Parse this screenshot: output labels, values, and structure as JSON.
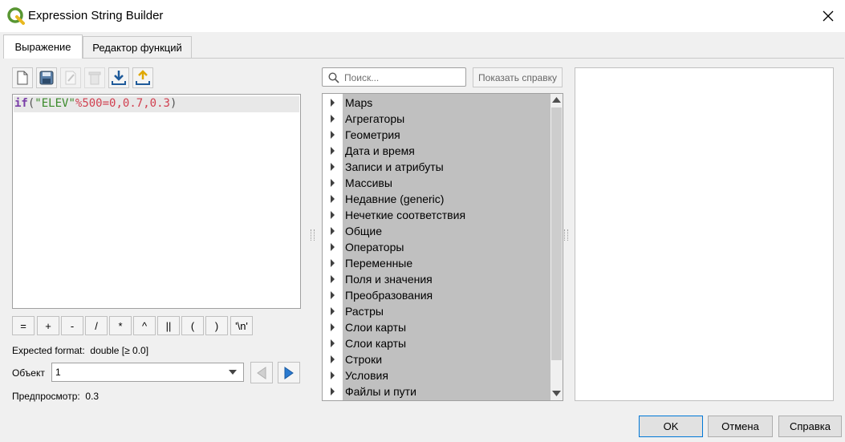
{
  "window": {
    "title": "Expression String Builder"
  },
  "tabs": [
    {
      "label": "Выражение"
    },
    {
      "label": "Редактор функций"
    }
  ],
  "editor": {
    "tokens": {
      "fn": "if",
      "open": "(",
      "field": "\"ELEV\"",
      "op1": "%",
      "n1": "500",
      "op2": "=",
      "n2": "0",
      "c1": ",",
      "n3": "0.7",
      "c2": ",",
      "n4": "0.3",
      "close": ")"
    }
  },
  "toolbar_icons": [
    "new-file-icon",
    "save-icon",
    "edit-icon",
    "delete-icon",
    "import-icon",
    "export-icon"
  ],
  "operators": [
    "=",
    "+",
    "-",
    "/",
    "*",
    "^",
    "||",
    "(",
    ")",
    "'\\n'"
  ],
  "expected_format": {
    "label": "Expected format:",
    "value": "double [≥ 0.0]"
  },
  "object": {
    "label": "Объект",
    "value": "1"
  },
  "preview": {
    "label": "Предпросмотр:",
    "value": "0.3"
  },
  "search": {
    "placeholder": "Поиск..."
  },
  "help_button": "Показать справку",
  "function_groups": [
    "Maps",
    "Агрегаторы",
    "Геометрия",
    "Дата и время",
    "Записи и атрибуты",
    "Массивы",
    "Недавние (generic)",
    "Нечеткие соответствия",
    "Общие",
    "Операторы",
    "Переменные",
    "Поля и значения",
    "Преобразования",
    "Растры",
    "Слои карты",
    "Слои карты",
    "Строки",
    "Условия",
    "Файлы и пути"
  ],
  "buttons": {
    "ok": "OK",
    "cancel": "Отмена",
    "help": "Справка"
  },
  "colors": {
    "accent": "#0078d7",
    "keyword": "#7a3ea8",
    "string": "#3a8a2a",
    "number": "#d14050"
  }
}
